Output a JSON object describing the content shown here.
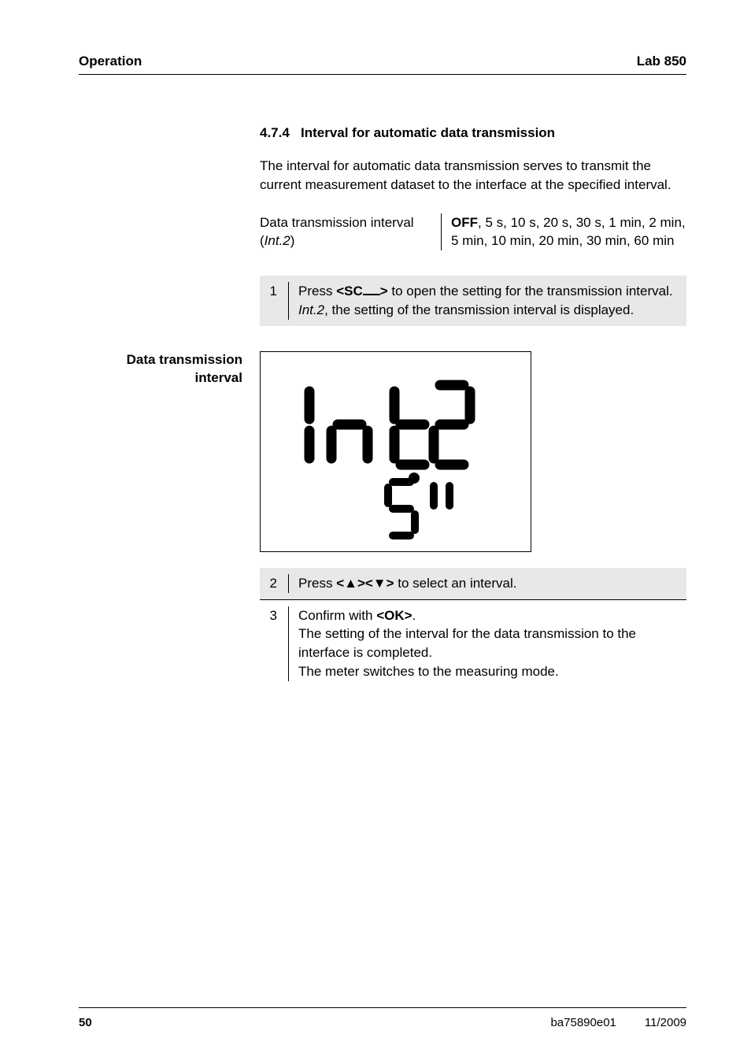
{
  "header": {
    "left": "Operation",
    "right": "Lab 850"
  },
  "section": {
    "number": "4.7.4",
    "title": "Interval for automatic data transmission"
  },
  "intro": "The interval for automatic data transmission serves to transmit the current measurement dataset to the interface at the specified interval.",
  "definition": {
    "label_plain": "Data transmission interval (",
    "label_ital": "Int.2",
    "label_close": ")",
    "value_bold": "OFF",
    "value_rest": ", 5 s, 10 s, 20 s, 30 s, 1 min, 2 min, 5 min, 10 min, 20 min, 30 min, 60 min"
  },
  "steps": {
    "s1": {
      "num": "1",
      "pre": "Press ",
      "key_open": "<SC",
      "key_close": ">",
      "post": " to open the setting for the transmission interval. ",
      "ital": "Int.2",
      "tail": ", the setting of the transmission interval is displayed."
    },
    "s2": {
      "num": "2",
      "pre": "Press ",
      "key1": "<▲>",
      "key2": "<▼>",
      "post": " to select an interval."
    },
    "s3": {
      "num": "3",
      "pre": "Confirm with ",
      "key": "<OK>",
      "post1": ".",
      "line2": "The setting of the interval for the data transmission to the interface is completed.",
      "line3": "The meter switches to the measuring mode."
    }
  },
  "side_label": {
    "line1": "Data transmission",
    "line2": "interval"
  },
  "display": {
    "big": "Int.2",
    "small": "5''"
  },
  "footer": {
    "page": "50",
    "doc": "ba75890e01",
    "date": "11/2009"
  }
}
